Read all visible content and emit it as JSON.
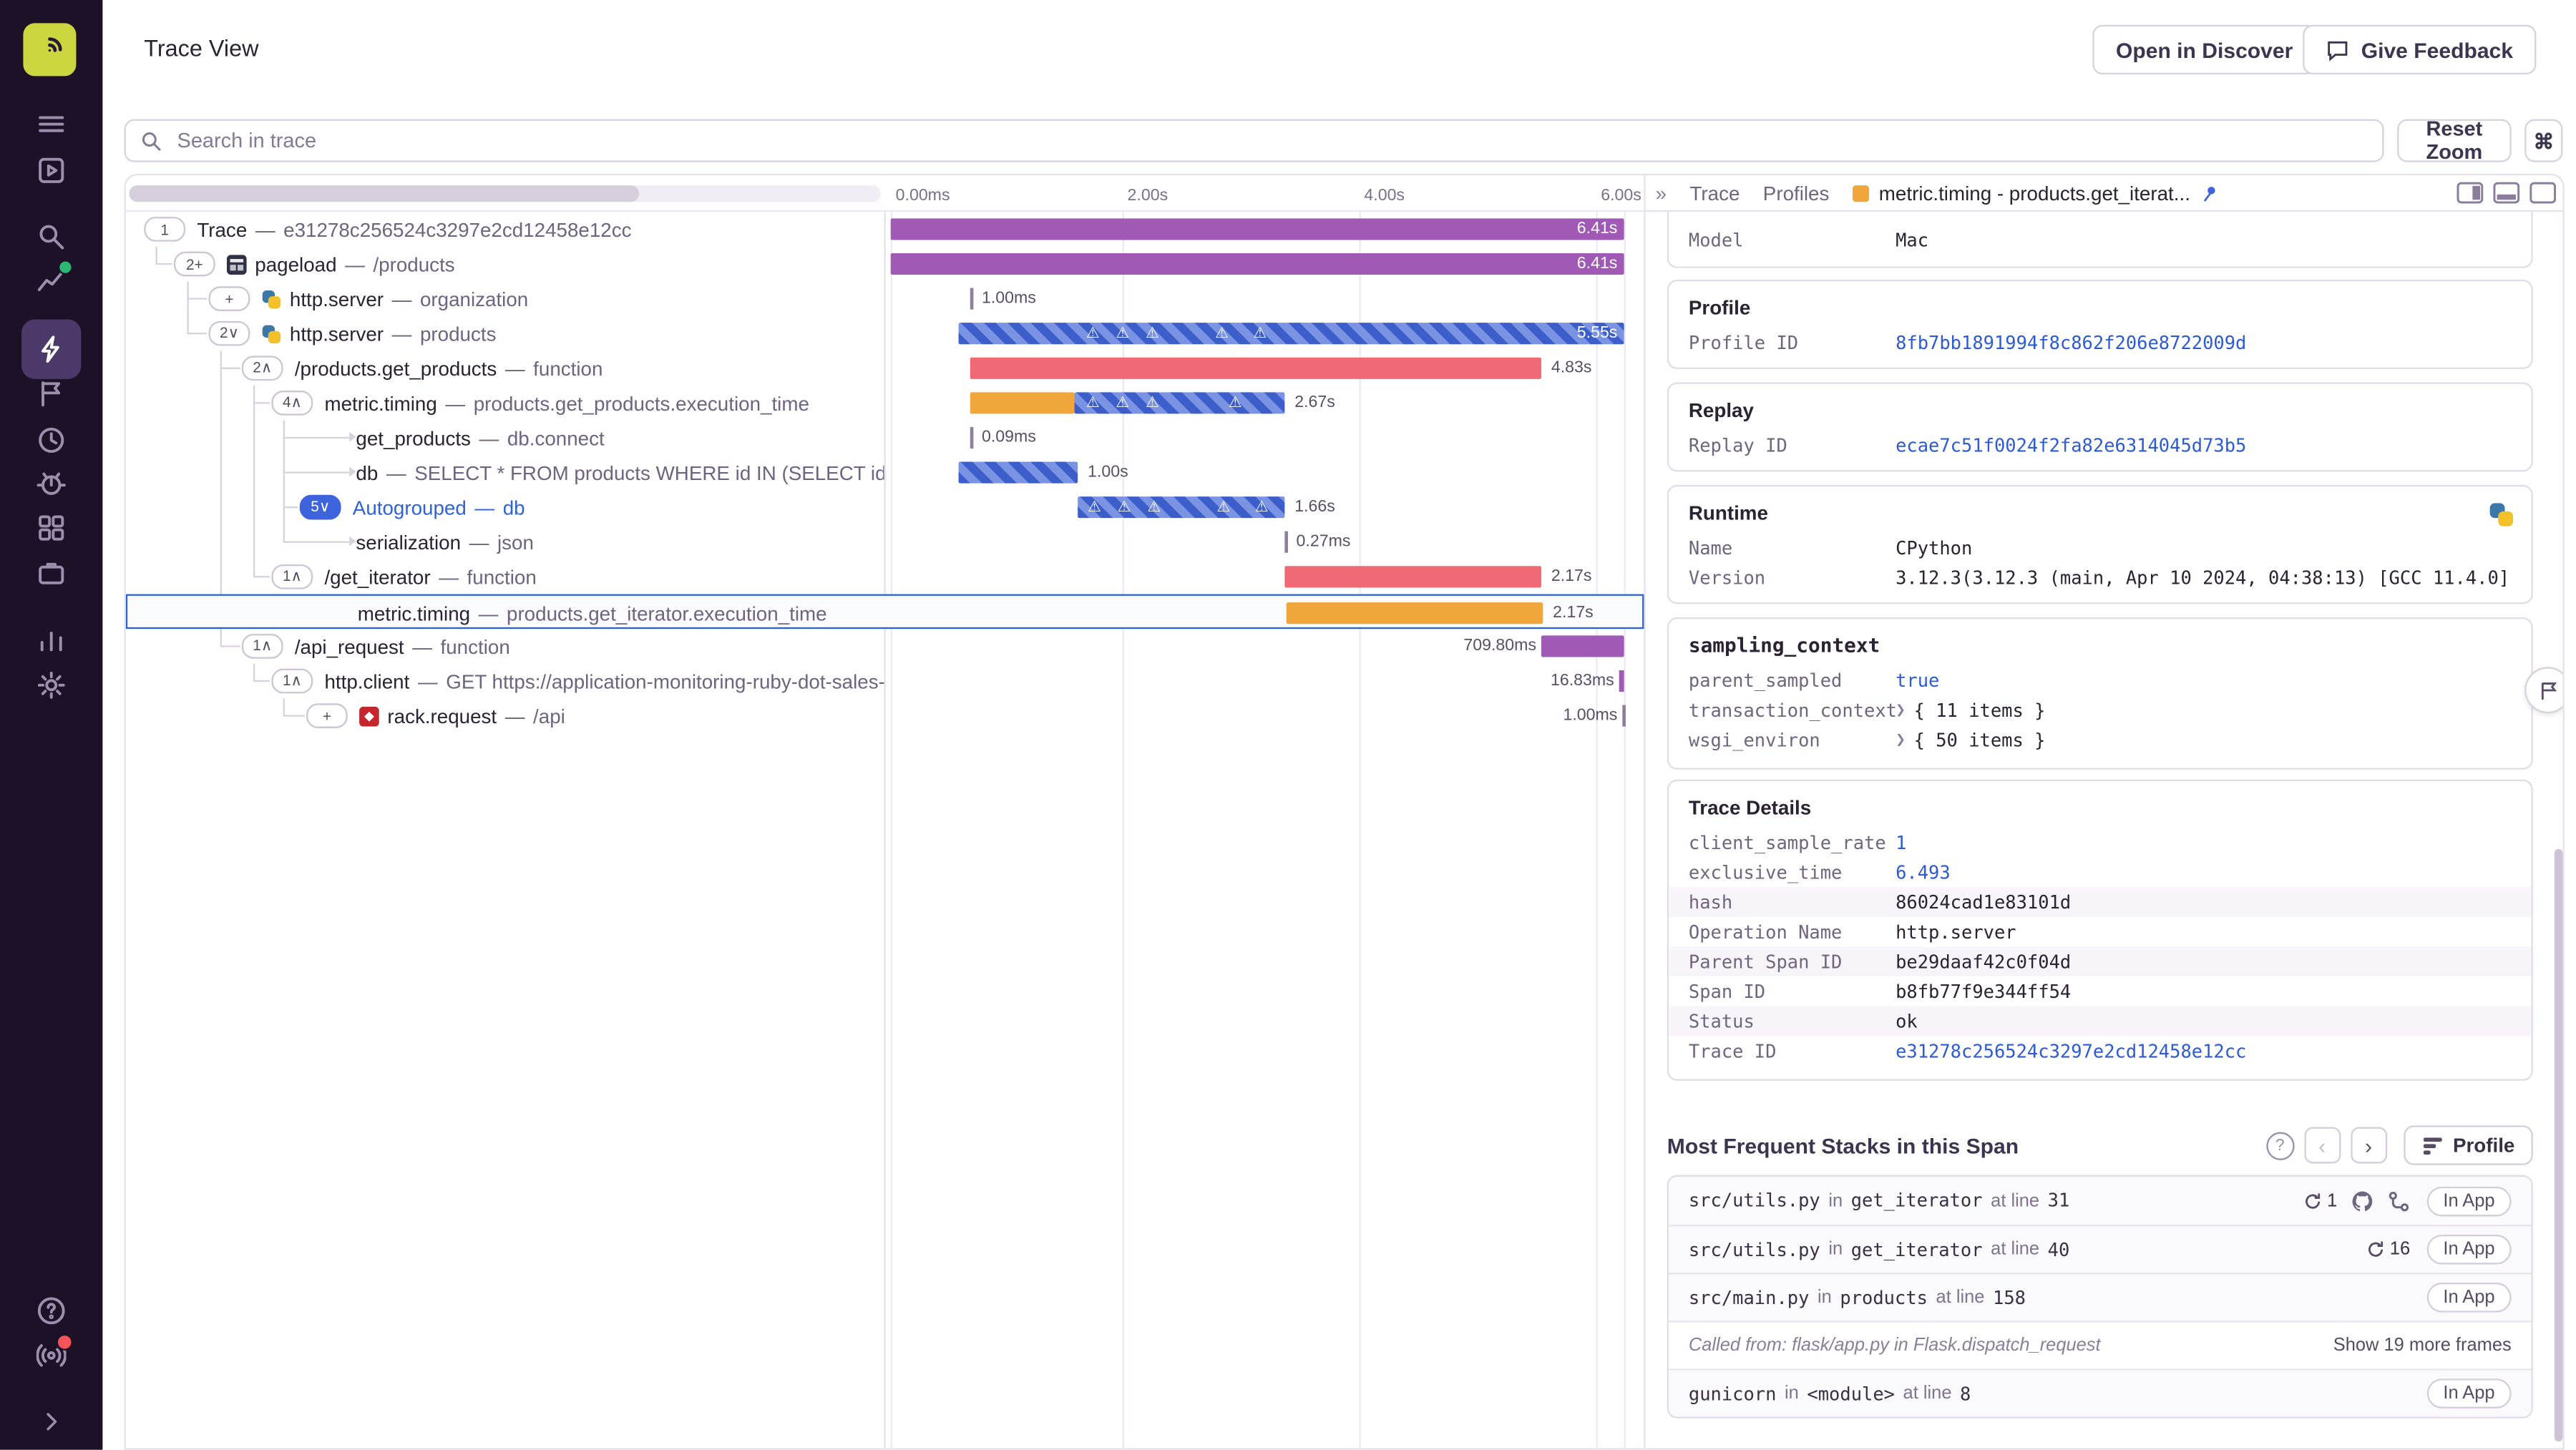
{
  "header": {
    "title": "Trace View",
    "open_discover": "Open in Discover",
    "give_feedback": "Give Feedback"
  },
  "toolbar": {
    "search_placeholder": "Search in trace",
    "reset_zoom": "Reset Zoom",
    "shortcut": "⌘"
  },
  "axis": [
    "0.00ms",
    "2.00s",
    "4.00s",
    "6.00s"
  ],
  "tabs": {
    "trace": "Trace",
    "profiles": "Profiles",
    "active": "metric.timing - products.get_iterat..."
  },
  "sep": "—",
  "tokens": {
    "in": "in",
    "at_line": "at line"
  },
  "rows": [
    {
      "badge": "1",
      "op": "Trace",
      "desc": "e31278c256524c3297e2cd12458e12cc",
      "duration": "6.41s"
    },
    {
      "badge": "2+",
      "op": "pageload",
      "desc": "/products",
      "duration": "6.41s"
    },
    {
      "badge": "+",
      "op": "http.server",
      "desc": "organization",
      "duration": "1.00ms"
    },
    {
      "badge": "2∨",
      "op": "http.server",
      "desc": "products",
      "duration": "5.55s"
    },
    {
      "badge": "2∧",
      "op": "/products.get_products",
      "desc": "function",
      "duration": "4.83s"
    },
    {
      "badge": "4∧",
      "op": "metric.timing",
      "desc": "products.get_products.execution_time",
      "duration": "2.67s"
    },
    {
      "op": "get_products",
      "desc": "db.connect",
      "duration": "0.09ms"
    },
    {
      "op": "db",
      "desc": "SELECT * FROM products WHERE id IN (SELECT id from produc",
      "duration": "1.00s"
    },
    {
      "badge": "5∨",
      "op": "Autogrouped",
      "desc": "db",
      "duration": "1.66s"
    },
    {
      "op": "serialization",
      "desc": "json",
      "duration": "0.27ms"
    },
    {
      "badge": "1∧",
      "op": "/get_iterator",
      "desc": "function",
      "duration": "2.17s"
    },
    {
      "op": "metric.timing",
      "desc": "products.get_iterator.execution_time",
      "duration": "2.17s"
    },
    {
      "badge": "1∧",
      "op": "/api_request",
      "desc": "function",
      "duration": "709.80ms"
    },
    {
      "badge": "1∧",
      "op": "http.client",
      "desc": "GET https://application-monitoring-ruby-dot-sales-eng",
      "duration": "16.83ms"
    },
    {
      "badge": "+",
      "op": "rack.request",
      "desc": "/api",
      "duration": "1.00ms"
    }
  ],
  "details": {
    "model_key": "Model",
    "model_value": "Mac",
    "profile_title": "Profile",
    "profile_id_label": "Profile ID",
    "profile_id": "8fb7bb1891994f8c862f206e8722009d",
    "replay_title": "Replay",
    "replay_id_label": "Replay ID",
    "replay_id": "ecae7c51f0024f2fa82e6314045d73b5",
    "runtime_title": "Runtime",
    "runtime_rows": [
      {
        "k": "Name",
        "v": "CPython"
      },
      {
        "k": "Version",
        "v": "3.12.3(3.12.3 (main, Apr 10 2024, 04:38:13) [GCC 11.4.0])"
      }
    ],
    "sampling_title": "sampling_context",
    "sampling_rows": [
      {
        "k": "parent_sampled",
        "v": "true"
      },
      {
        "k": "transaction_context",
        "v": "{ 11 items }"
      },
      {
        "k": "wsgi_environ",
        "v": "{ 50 items }"
      }
    ],
    "trace_details_title": "Trace Details",
    "trace_details_rows": [
      {
        "k": "client_sample_rate",
        "v": "1"
      },
      {
        "k": "exclusive_time",
        "v": "6.493"
      },
      {
        "k": "hash",
        "v": "86024cad1e83101d"
      },
      {
        "k": "Operation Name",
        "v": "http.server"
      },
      {
        "k": "Parent Span ID",
        "v": "be29daaf42c0f04d"
      },
      {
        "k": "Span ID",
        "v": "b8fb77f9e344ff54"
      },
      {
        "k": "Status",
        "v": "ok"
      },
      {
        "k": "Trace ID",
        "v": "e31278c256524c3297e2cd12458e12cc"
      }
    ]
  },
  "stacks": {
    "title": "Most Frequent Stacks in this Span",
    "profile_button": "Profile",
    "rows": [
      {
        "file": "src/utils.py",
        "func": "get_iterator",
        "line": "31",
        "count": "1",
        "badge": "In App"
      },
      {
        "file": "src/utils.py",
        "func": "get_iterator",
        "line": "40",
        "count": "16",
        "badge": "In App"
      },
      {
        "file": "src/main.py",
        "func": "products",
        "line": "158",
        "badge": "In App"
      },
      {
        "called_from": "Called from: flask/app.py in Flask.dispatch_request",
        "more": "Show 19 more frames"
      },
      {
        "file": "gunicorn",
        "func": "<module>",
        "line": "8",
        "badge": "In App"
      }
    ]
  }
}
